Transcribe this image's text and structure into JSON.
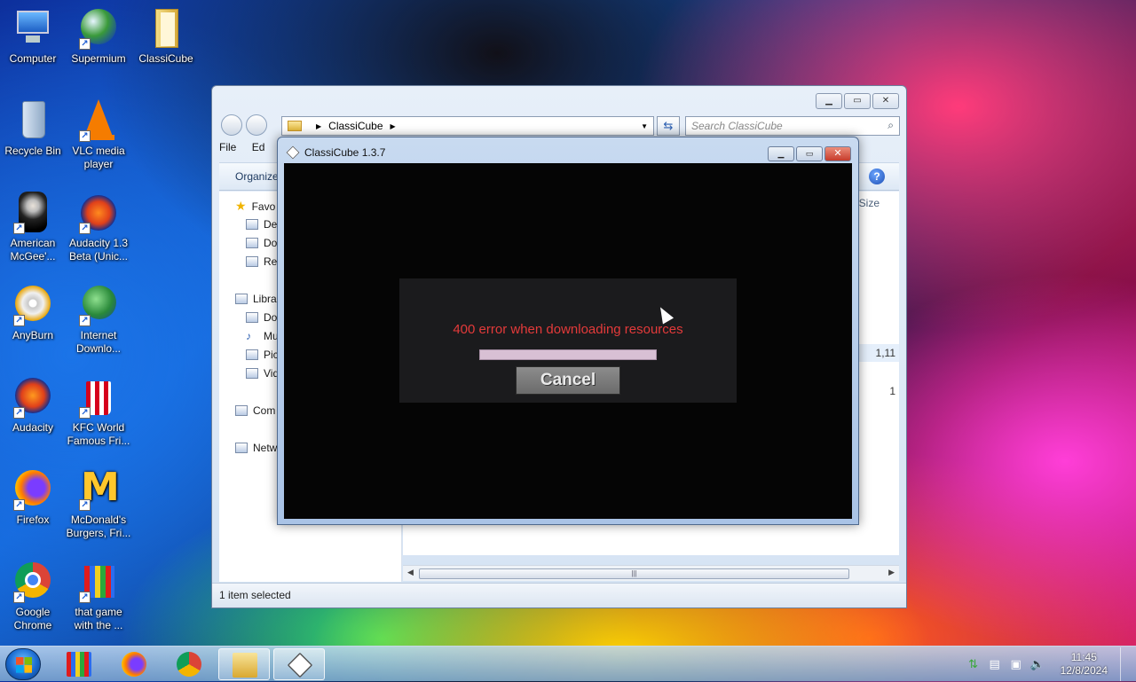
{
  "desktop": {
    "icons": [
      {
        "label": "Computer",
        "icon": "computer-icon"
      },
      {
        "label": "Supermium",
        "icon": "supermium-icon"
      },
      {
        "label": "ClassiCube",
        "icon": "folder-icon"
      },
      {
        "label": "Recycle Bin",
        "icon": "recycle-bin-icon"
      },
      {
        "label": "VLC media player",
        "icon": "vlc-icon"
      },
      {
        "label": "American McGee'...",
        "icon": "american-mcgee-icon"
      },
      {
        "label": "Audacity 1.3 Beta (Unic...",
        "icon": "audacity-beta-icon"
      },
      {
        "label": "AnyBurn",
        "icon": "anyburn-icon"
      },
      {
        "label": "Internet Downlo...",
        "icon": "internet-download-icon"
      },
      {
        "label": "Audacity",
        "icon": "audacity-icon"
      },
      {
        "label": "KFC  World Famous Fri...",
        "icon": "kfc-icon"
      },
      {
        "label": "Firefox",
        "icon": "firefox-icon"
      },
      {
        "label": "McDonald's Burgers, Fri...",
        "icon": "mcdonalds-icon"
      },
      {
        "label": "Google Chrome",
        "icon": "chrome-icon"
      },
      {
        "label": "that game with the ...",
        "icon": "that-game-icon"
      }
    ]
  },
  "explorer": {
    "address": "ClassiCube",
    "search_placeholder": "Search ClassiCube",
    "menu": {
      "file": "File",
      "edit": "Ed"
    },
    "toolbar": {
      "organize": "Organize"
    },
    "nav": {
      "favorites": "Favo",
      "desktop": "De",
      "downloads": "Do",
      "recent": "Re",
      "libraries": "Libra",
      "documents": "Do",
      "music": "Mu",
      "pictures": "Pic",
      "videos": "Vid",
      "computer": "Com",
      "network": "Netw"
    },
    "column_size": "Size",
    "row1_size": "1,11",
    "row2_size": "1",
    "status": "1 item selected"
  },
  "classicube": {
    "title": "ClassiCube 1.3.7",
    "error": "400 error when downloading resources",
    "cancel": "Cancel",
    "progress": 1.0,
    "colors": {
      "error": "#e33a3a",
      "progress": "#d8c0d4"
    }
  },
  "taskbar": {
    "time": "11:45",
    "date": "12/8/2024"
  }
}
